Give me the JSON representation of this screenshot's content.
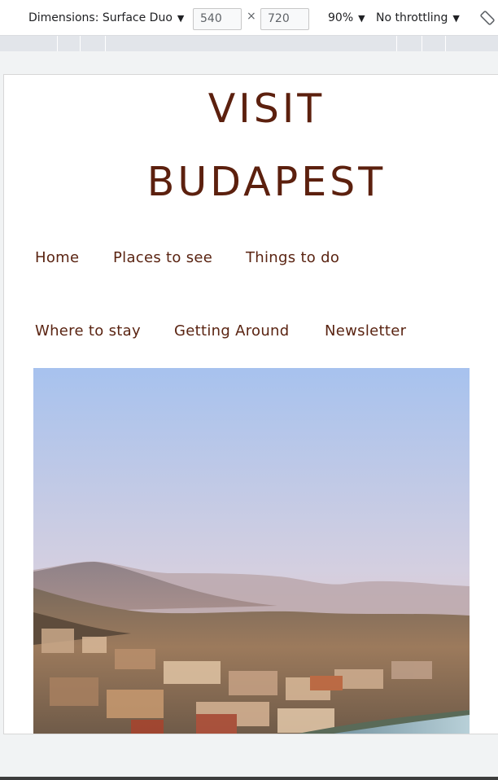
{
  "devtools": {
    "device_label": "Dimensions: Surface Duo",
    "width": "540",
    "height": "720",
    "times_symbol": "×",
    "zoom": "90%",
    "throttling": "No throttling",
    "icons": [
      "caret-down-icon",
      "rotate-icon"
    ]
  },
  "site": {
    "title_line1": "VISIT",
    "title_line2": "BUDAPEST",
    "nav": {
      "home": "Home",
      "places": "Places to see",
      "things": "Things to do",
      "stay": "Where to stay",
      "getting_around": "Getting Around",
      "newsletter": "Newsletter"
    },
    "colors": {
      "title": "#5c200e",
      "nav": "#5a2412"
    }
  }
}
